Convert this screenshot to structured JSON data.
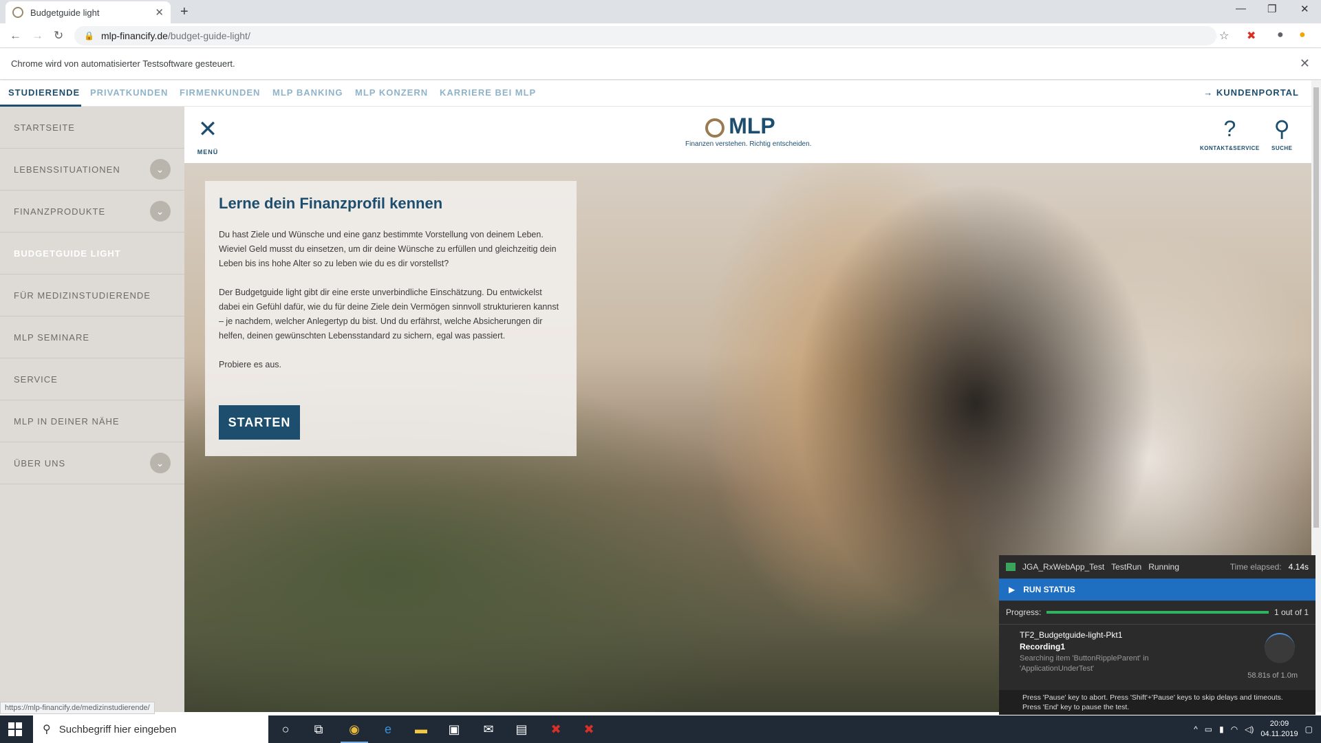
{
  "browser": {
    "tab_title": "Budgetguide light",
    "url_host": "mlp-financify.de",
    "url_path": "/budget-guide-light/",
    "automation_notice": "Chrome wird von automatisierter Testsoftware gesteuert.",
    "status_url": "https://mlp-financify.de/medizinstudierende/"
  },
  "topnav": {
    "items": [
      "STUDIERENDE",
      "PRIVATKUNDEN",
      "FIRMENKUNDEN",
      "MLP BANKING",
      "MLP KONZERN",
      "KARRIERE BEI MLP"
    ],
    "kundenportal": "KUNDENPORTAL"
  },
  "sidebar": {
    "items": [
      {
        "label": "STARTSEITE"
      },
      {
        "label": "LEBENSSITUATIONEN"
      },
      {
        "label": "FINANZPRODUKTE"
      },
      {
        "label": "BUDGETGUIDE LIGHT"
      },
      {
        "label": "FÜR MEDIZINSTUDIERENDE"
      },
      {
        "label": "MLP SEMINARE"
      },
      {
        "label": "SERVICE"
      },
      {
        "label": "MLP IN DEINER NÄHE"
      },
      {
        "label": "ÜBER UNS"
      }
    ]
  },
  "header": {
    "menu_label": "MENÜ",
    "logo_text": "MLP",
    "tagline": "Finanzen verstehen. Richtig entscheiden.",
    "kontakt_label": "KONTAKT&SERVICE",
    "suche_label": "SUCHE"
  },
  "card": {
    "title": "Lerne dein Finanzprofil kennen",
    "p1": "Du hast Ziele und Wünsche und eine ganz bestimmte Vorstellung von deinem Leben. Wieviel Geld musst du einsetzen, um dir deine Wünsche zu erfüllen und gleichzeitig dein Leben bis ins hohe Alter so zu leben wie du es dir vorstellst?",
    "p2": "Der Budgetguide light gibt dir eine erste unverbindliche Einschätzung. Du entwickelst dabei ein Gefühl dafür, wie du für deine Ziele dein Vermögen sinnvoll strukturieren kannst – je nachdem, welcher Anlegertyp du bist. Und du erfährst, welche Absicherungen dir helfen, deinen gewünschten Lebensstandard zu sichern, egal was passiert.",
    "p3": "Probiere es aus.",
    "button": "STARTEN"
  },
  "ranorex": {
    "project": "JGA_RxWebApp_Test",
    "run": "TestRun",
    "state": "Running",
    "elapsed_label": "Time elapsed:",
    "elapsed": "4.14s",
    "run_status": "RUN STATUS",
    "progress_label": "Progress:",
    "progress_text": "1 out of 1",
    "progress_fraction": 1.0,
    "testcase": "TF2_Budgetguide-light-Pkt1",
    "recording": "Recording1",
    "searching": "Searching item 'ButtonRippleParent' in 'ApplicationUnderTest'",
    "duration": "58.81s of 1.0m",
    "hint1": "Press 'Pause' key to abort. Press 'Shift'+'Pause' keys to skip delays and timeouts.",
    "hint2": "Press 'End' key to pause the test."
  },
  "taskbar": {
    "search_placeholder": "Suchbegriff hier eingeben",
    "time": "20:09",
    "date": "04.11.2019"
  }
}
